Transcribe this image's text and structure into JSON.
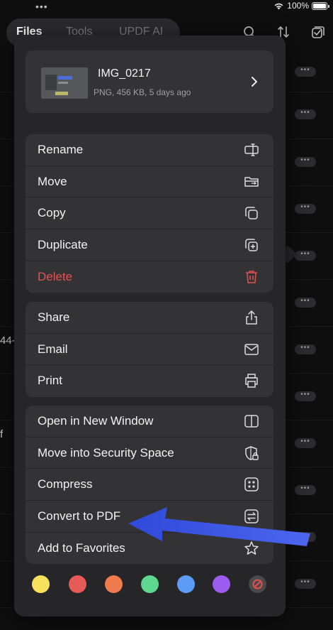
{
  "status_bar": {
    "dots": "•••",
    "battery": "100%"
  },
  "tabs": [
    {
      "label": "Files",
      "active": true
    },
    {
      "label": "Tools",
      "active": false
    },
    {
      "label": "UPDF AI",
      "active": false
    }
  ],
  "toolbar_icons": [
    "search-icon",
    "sort-icon",
    "select-icon"
  ],
  "background": {
    "more": "•••",
    "fragments": [
      "44-",
      "f"
    ]
  },
  "file": {
    "name": "IMG_0217",
    "meta": "PNG, 456 KB, 5 days ago"
  },
  "menu": {
    "group1": [
      {
        "label": "Rename",
        "icon": "rename-icon"
      },
      {
        "label": "Move",
        "icon": "move-folder-icon"
      },
      {
        "label": "Copy",
        "icon": "copy-icon"
      },
      {
        "label": "Duplicate",
        "icon": "duplicate-icon"
      },
      {
        "label": "Delete",
        "icon": "trash-icon"
      }
    ],
    "group2": [
      {
        "label": "Share",
        "icon": "share-icon"
      },
      {
        "label": "Email",
        "icon": "envelope-icon"
      },
      {
        "label": "Print",
        "icon": "printer-icon"
      }
    ],
    "group3": [
      {
        "label": "Open in New Window",
        "icon": "split-window-icon"
      },
      {
        "label": "Move into Security Space",
        "icon": "shield-lock-icon"
      },
      {
        "label": "Compress",
        "icon": "compress-icon"
      },
      {
        "label": "Convert to PDF",
        "icon": "convert-icon"
      },
      {
        "label": "Add to Favorites",
        "icon": "star-icon"
      }
    ]
  },
  "tag_colors": [
    "#f7e15c",
    "#e65b58",
    "#ef7b4f",
    "#5ed891",
    "#5c9cf6",
    "#9d5cf0"
  ],
  "no_tag_icon": "no-tag-icon",
  "colors": {
    "danger": "#e5514f",
    "annotation_arrow": "#3b55e6",
    "panel": "#262628",
    "card": "#333335"
  }
}
